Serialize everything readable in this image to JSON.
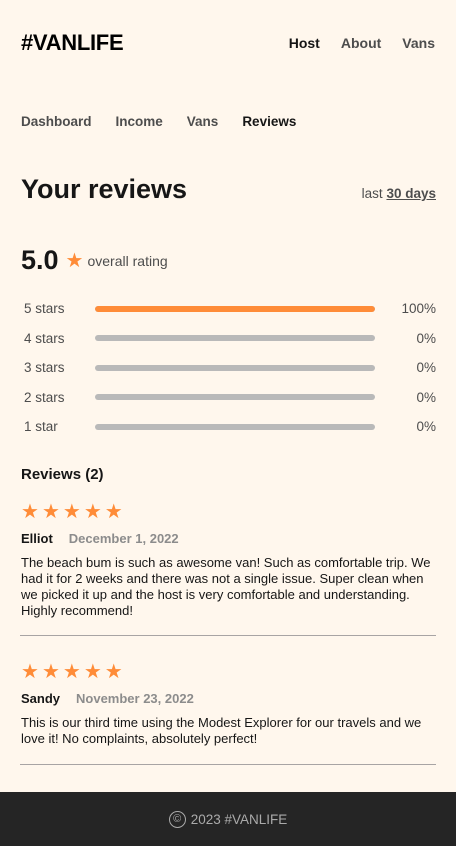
{
  "header": {
    "logo": "#VANLIFE",
    "nav": [
      {
        "label": "Host",
        "active": true
      },
      {
        "label": "About",
        "active": false
      },
      {
        "label": "Vans",
        "active": false
      }
    ]
  },
  "subnav": [
    {
      "label": "Dashboard",
      "active": false
    },
    {
      "label": "Income",
      "active": false
    },
    {
      "label": "Vans",
      "active": false
    },
    {
      "label": "Reviews",
      "active": true
    }
  ],
  "page": {
    "title": "Your reviews",
    "range_prefix": "last",
    "range_value": "30 days"
  },
  "overall": {
    "score": "5.0",
    "star_icon": "★",
    "label": "overall rating"
  },
  "rating_breakdown": [
    {
      "label": "5 stars",
      "fraction": 1.0,
      "percent_text": "100%"
    },
    {
      "label": "4 stars",
      "fraction": 0.0,
      "percent_text": "0%"
    },
    {
      "label": "3 stars",
      "fraction": 0.0,
      "percent_text": "0%"
    },
    {
      "label": "2 stars",
      "fraction": 0.0,
      "percent_text": "0%"
    },
    {
      "label": "1 star",
      "fraction": 0.0,
      "percent_text": "0%"
    }
  ],
  "reviews_heading": "Reviews (2)",
  "reviews": [
    {
      "rating": 5,
      "name": "Elliot",
      "date": "December 1, 2022",
      "text": "The beach bum is such as awesome van! Such as comfortable trip. We had it for 2 weeks and there was not a single issue. Super clean when we picked it up and the host is very comfortable and understanding. Highly recommend!"
    },
    {
      "rating": 5,
      "name": "Sandy",
      "date": "November 23, 2022",
      "text": "This is our third time using the Modest Explorer for our travels and we love it! No complaints, absolutely perfect!"
    }
  ],
  "footer": {
    "copyright_icon": "©",
    "text": "2023 #VANLIFE"
  },
  "colors": {
    "background": "#FFF7ED",
    "accent": "#FF8C38",
    "bar_empty": "#B9B9B9",
    "footer_bg": "#252525"
  }
}
